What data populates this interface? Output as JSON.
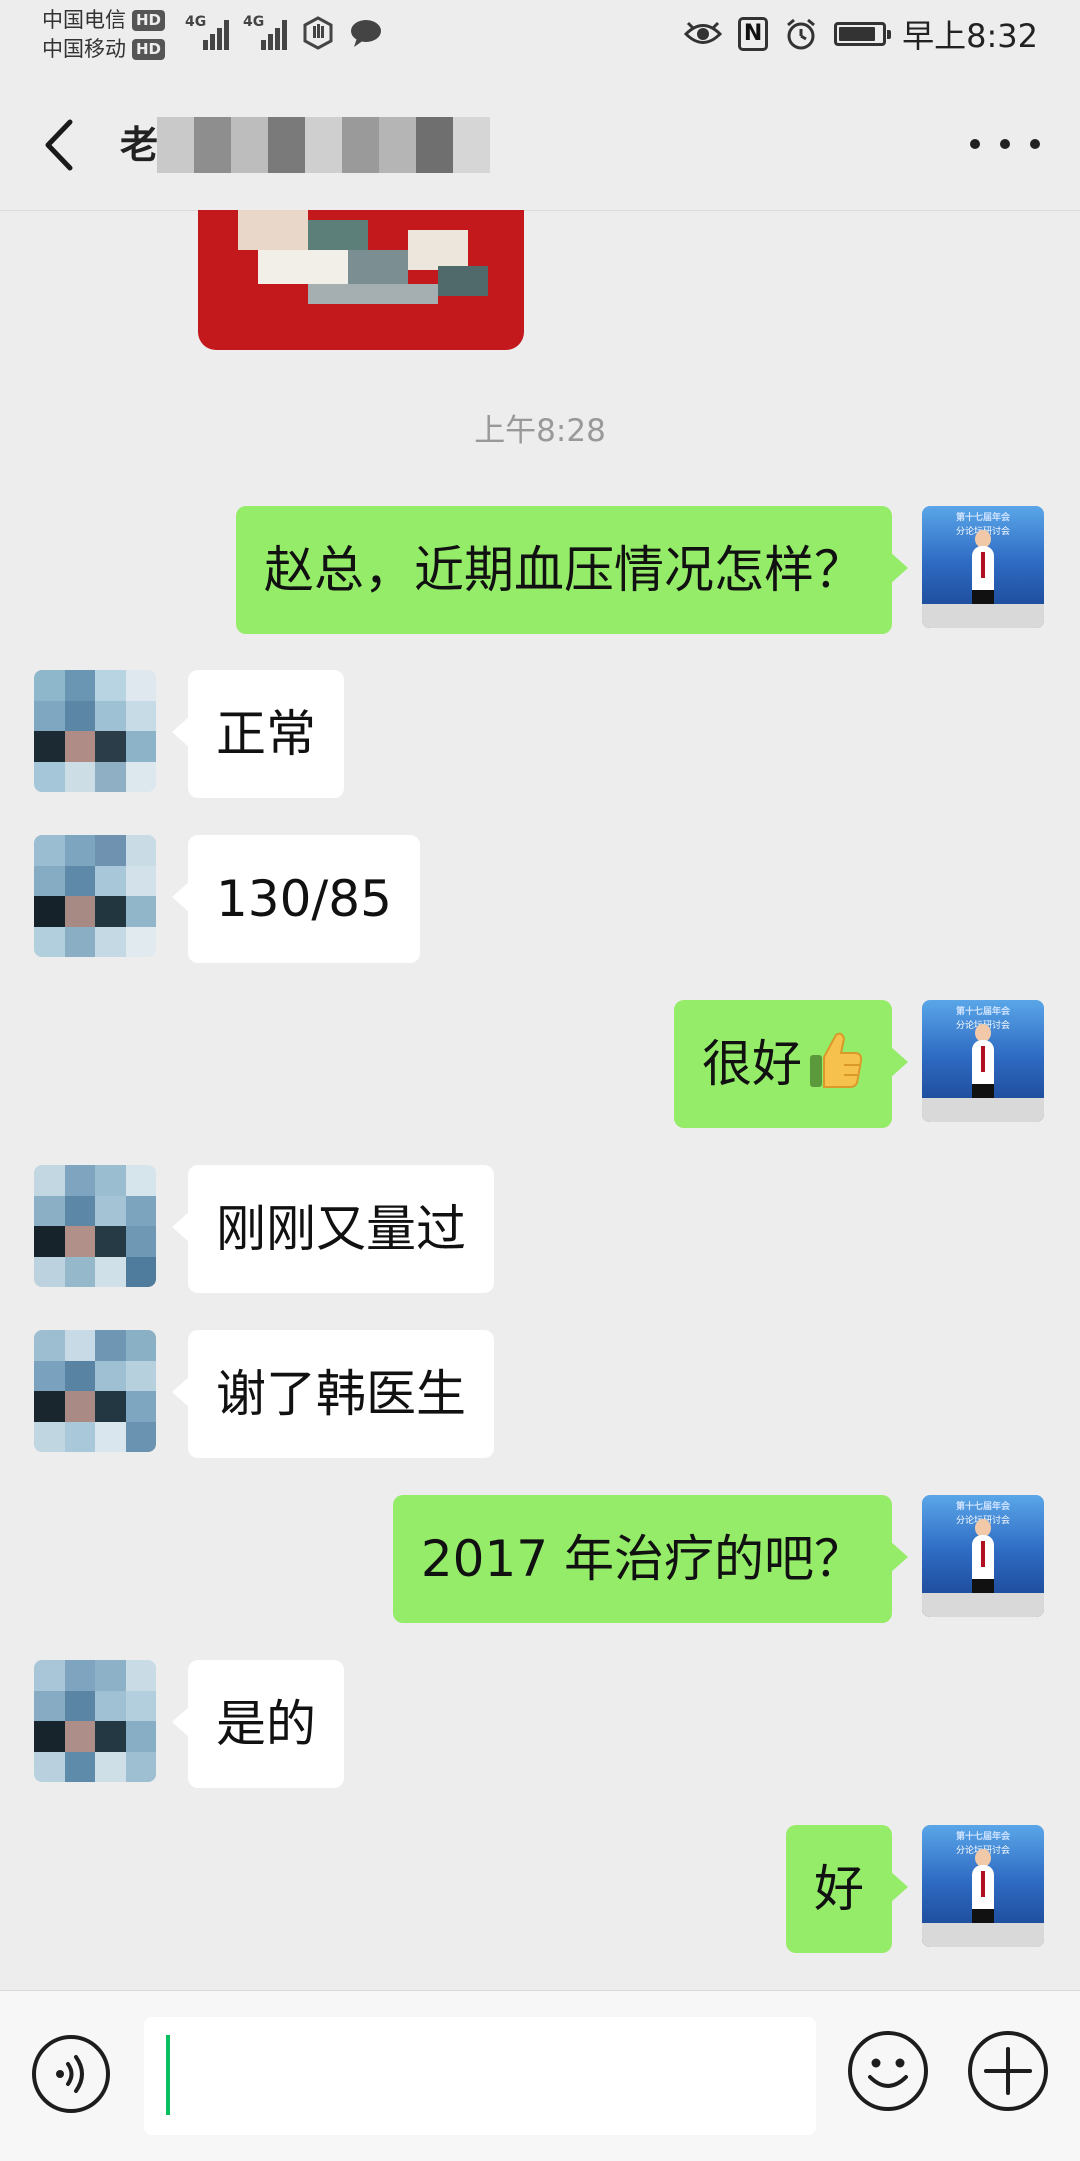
{
  "status_bar": {
    "carrier1": "中国电信",
    "carrier2": "中国移动",
    "hd_label": "HD",
    "net1": "4G",
    "net2": "4G",
    "time": "早上8:32",
    "nfc_label": "N",
    "battery_level": 0.85
  },
  "header": {
    "title": "老"
  },
  "chat": {
    "timestamp": "上午8:28",
    "messages": [
      {
        "from": "me",
        "text": "赵总，近期血压情况怎样？"
      },
      {
        "from": "them",
        "text": "正常"
      },
      {
        "from": "them",
        "text": "130/85"
      },
      {
        "from": "me",
        "text": "很好",
        "emoji": "thumbs-up"
      },
      {
        "from": "them",
        "text": "刚刚又量过"
      },
      {
        "from": "them",
        "text": "谢了韩医生"
      },
      {
        "from": "me",
        "text": "2017 年治疗的吧？"
      },
      {
        "from": "them",
        "text": "是的"
      },
      {
        "from": "me",
        "text": "好"
      }
    ]
  },
  "input_bar": {
    "value": "",
    "voice_icon": "voice-icon",
    "emoji_icon": "smiley-icon",
    "plus_icon": "plus-icon"
  },
  "colors": {
    "background": "#ededed",
    "my_bubble": "#95ec69",
    "their_bubble": "#ffffff",
    "accent": "#07c160"
  }
}
